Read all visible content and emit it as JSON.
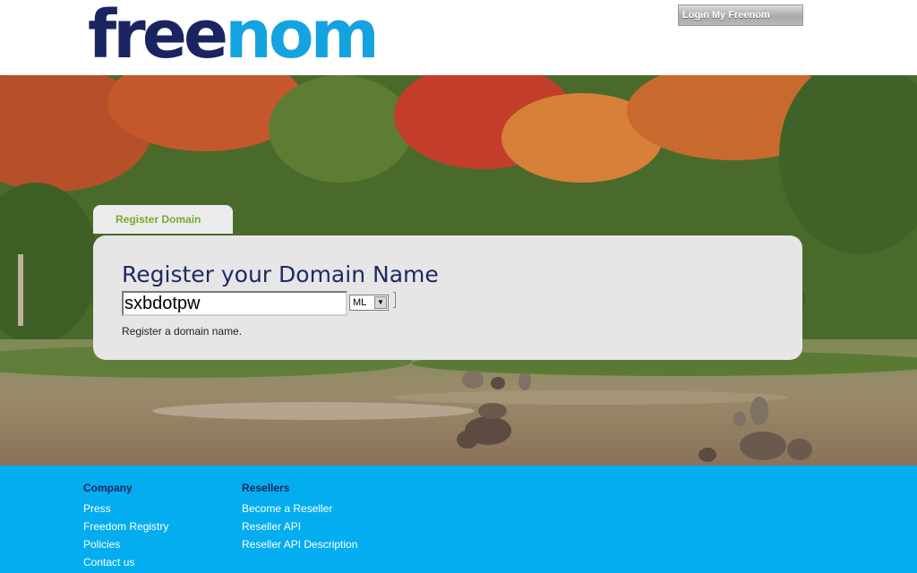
{
  "header": {
    "logo_part1": "free",
    "logo_part2": "nom",
    "login_label": "Login My Freenom"
  },
  "register": {
    "tab_label": "Register Domain",
    "title": "Register your Domain Name",
    "domain_value": "sxbdotpw",
    "tld_selected": "ML",
    "help_text": "Register a domain name."
  },
  "footer": {
    "company": {
      "heading": "Company",
      "links": [
        "Press",
        "Freedom Registry",
        "Policies",
        "Contact us"
      ]
    },
    "resellers": {
      "heading": "Resellers",
      "links": [
        "Become a Reseller",
        "Reseller API",
        "Reseller API Description"
      ]
    }
  },
  "colors": {
    "brand_dark": "#1a2460",
    "brand_blue": "#14a3e0",
    "footer_bg": "#04adef",
    "tab_text": "#7aa82c"
  }
}
